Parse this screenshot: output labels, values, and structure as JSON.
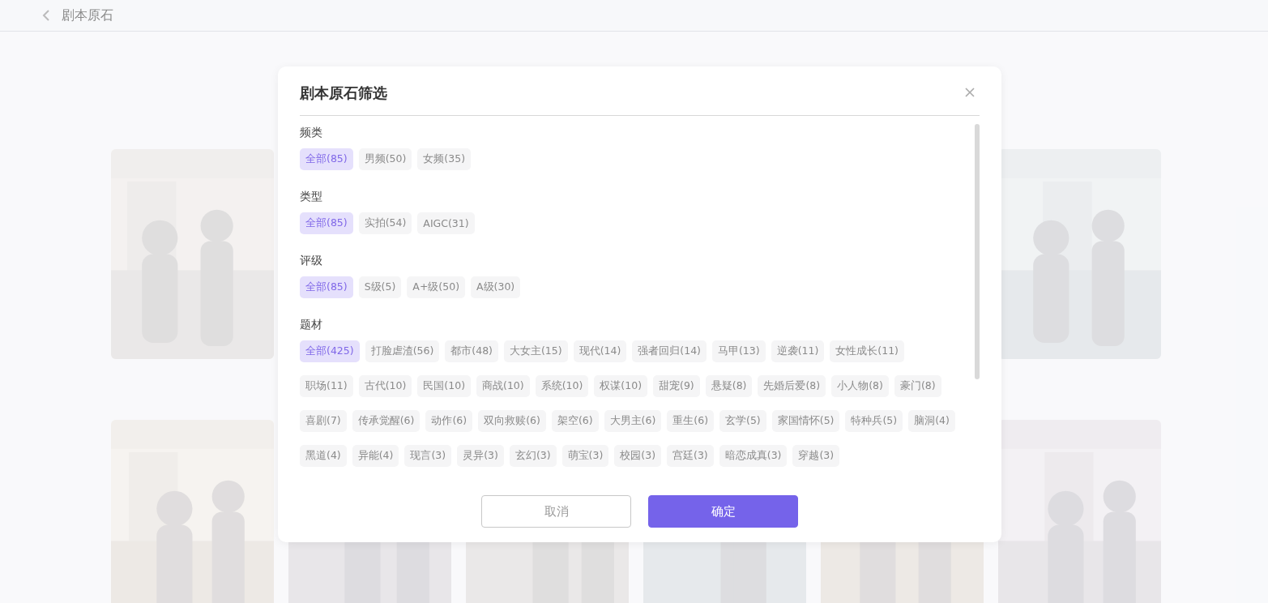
{
  "background": {
    "page_title": "剧本原石"
  },
  "dialog": {
    "title": "剧本原石筛选",
    "groups": [
      {
        "label": "频类",
        "tags": [
          {
            "label": "全部(85)",
            "selected": true
          },
          {
            "label": "男频(50)",
            "selected": false
          },
          {
            "label": "女频(35)",
            "selected": false
          }
        ]
      },
      {
        "label": "类型",
        "tags": [
          {
            "label": "全部(85)",
            "selected": true
          },
          {
            "label": "实拍(54)",
            "selected": false
          },
          {
            "label": "AIGC(31)",
            "selected": false
          }
        ]
      },
      {
        "label": "评级",
        "tags": [
          {
            "label": "全部(85)",
            "selected": true
          },
          {
            "label": "S级(5)",
            "selected": false
          },
          {
            "label": "A+级(50)",
            "selected": false
          },
          {
            "label": "A级(30)",
            "selected": false
          }
        ]
      },
      {
        "label": "题材",
        "tags": [
          {
            "label": "全部(425)",
            "selected": true
          },
          {
            "label": "打脸虐渣(56)",
            "selected": false
          },
          {
            "label": "都市(48)",
            "selected": false
          },
          {
            "label": "大女主(15)",
            "selected": false
          },
          {
            "label": "现代(14)",
            "selected": false
          },
          {
            "label": "强者回归(14)",
            "selected": false
          },
          {
            "label": "马甲(13)",
            "selected": false
          },
          {
            "label": "逆袭(11)",
            "selected": false
          },
          {
            "label": "女性成长(11)",
            "selected": false
          },
          {
            "label": "职场(11)",
            "selected": false
          },
          {
            "label": "古代(10)",
            "selected": false
          },
          {
            "label": "民国(10)",
            "selected": false
          },
          {
            "label": "商战(10)",
            "selected": false
          },
          {
            "label": "系统(10)",
            "selected": false
          },
          {
            "label": "权谋(10)",
            "selected": false
          },
          {
            "label": "甜宠(9)",
            "selected": false
          },
          {
            "label": "悬疑(8)",
            "selected": false
          },
          {
            "label": "先婚后爱(8)",
            "selected": false
          },
          {
            "label": "小人物(8)",
            "selected": false
          },
          {
            "label": "豪门(8)",
            "selected": false
          },
          {
            "label": "喜剧(7)",
            "selected": false
          },
          {
            "label": "传承觉醒(6)",
            "selected": false
          },
          {
            "label": "动作(6)",
            "selected": false
          },
          {
            "label": "双向救赎(6)",
            "selected": false
          },
          {
            "label": "架空(6)",
            "selected": false
          },
          {
            "label": "大男主(6)",
            "selected": false
          },
          {
            "label": "重生(6)",
            "selected": false
          },
          {
            "label": "玄学(5)",
            "selected": false
          },
          {
            "label": "家国情怀(5)",
            "selected": false
          },
          {
            "label": "特种兵(5)",
            "selected": false
          },
          {
            "label": "脑洞(4)",
            "selected": false
          },
          {
            "label": "黑道(4)",
            "selected": false
          },
          {
            "label": "异能(4)",
            "selected": false
          },
          {
            "label": "现言(3)",
            "selected": false
          },
          {
            "label": "灵异(3)",
            "selected": false
          },
          {
            "label": "玄幻(3)",
            "selected": false
          },
          {
            "label": "萌宝(3)",
            "selected": false
          },
          {
            "label": "校园(3)",
            "selected": false
          },
          {
            "label": "宫廷(3)",
            "selected": false
          },
          {
            "label": "暗恋成真(3)",
            "selected": false
          },
          {
            "label": "穿越(3)",
            "selected": false
          }
        ]
      }
    ],
    "buttons": [
      {
        "label": "取消",
        "kind": "secondary"
      },
      {
        "label": "确定",
        "kind": "primary"
      }
    ]
  }
}
